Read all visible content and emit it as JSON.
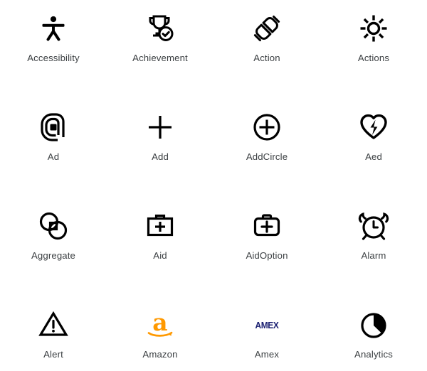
{
  "gallery": {
    "columns": 4,
    "background_color": "#ffffff",
    "label_color": "#3c4043",
    "icon_color": "#000000",
    "brand_colors": {
      "amazon_orange": "#FF9900",
      "amex_navy": "#1a1f71"
    },
    "items": [
      {
        "label": "Accessibility",
        "icon": "accessibility-icon"
      },
      {
        "label": "Achievement",
        "icon": "achievement-trophy-check-icon"
      },
      {
        "label": "Action",
        "icon": "action-plug-connector-icon"
      },
      {
        "label": "Actions",
        "icon": "actions-sun-burst-icon"
      },
      {
        "label": "Ad",
        "icon": "ad-spiral-square-icon"
      },
      {
        "label": "Add",
        "icon": "add-plus-icon"
      },
      {
        "label": "AddCircle",
        "icon": "add-circle-icon"
      },
      {
        "label": "Aed",
        "icon": "aed-heart-bolt-icon"
      },
      {
        "label": "Aggregate",
        "icon": "aggregate-overlap-circles-icon"
      },
      {
        "label": "Aid",
        "icon": "aid-kit-icon"
      },
      {
        "label": "AidOption",
        "icon": "aid-option-kit-icon"
      },
      {
        "label": "Alarm",
        "icon": "alarm-clock-icon"
      },
      {
        "label": "Alert",
        "icon": "alert-triangle-icon"
      },
      {
        "label": "Amazon",
        "icon": "amazon-logo-icon"
      },
      {
        "label": "Amex",
        "icon": "amex-logo-icon",
        "mark_text": "AMEX"
      },
      {
        "label": "Analytics",
        "icon": "analytics-pie-chart-icon"
      }
    ]
  }
}
